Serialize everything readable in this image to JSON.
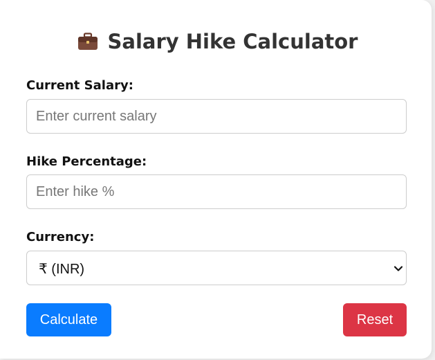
{
  "header": {
    "icon": "briefcase-icon",
    "title": "Salary Hike Calculator"
  },
  "form": {
    "current_salary": {
      "label": "Current Salary:",
      "value": "",
      "placeholder": "Enter current salary"
    },
    "hike_percentage": {
      "label": "Hike Percentage:",
      "value": "",
      "placeholder": "Enter hike %"
    },
    "currency": {
      "label": "Currency:",
      "selected": "₹ (INR)",
      "chevron_icon": "chevron-down-icon"
    }
  },
  "buttons": {
    "calculate_label": "Calculate",
    "reset_label": "Reset"
  },
  "colors": {
    "primary": "#0a7cff",
    "danger": "#dc3545",
    "text": "#333333",
    "border": "#cccccc"
  }
}
